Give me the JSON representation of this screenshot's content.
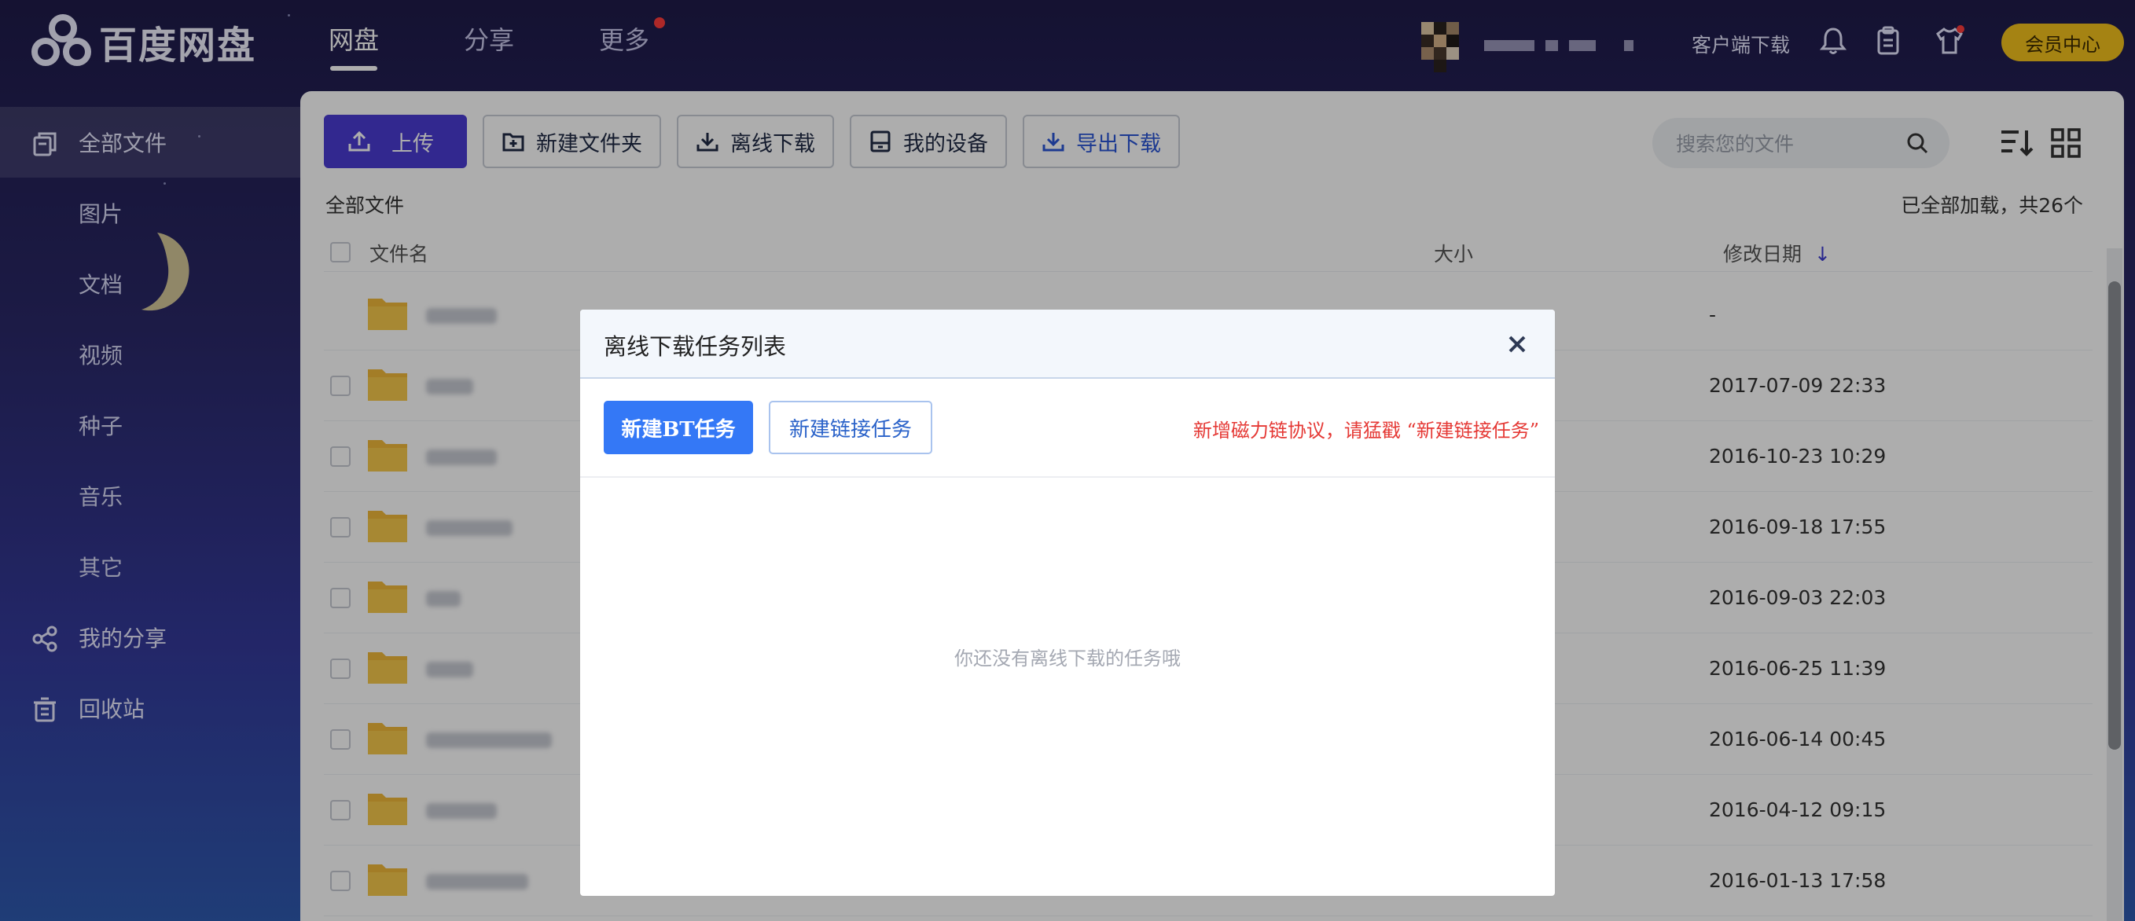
{
  "app": {
    "brand": "百度网盘"
  },
  "topnav": {
    "items": [
      {
        "label": "网盘",
        "active": true
      },
      {
        "label": "分享",
        "active": false
      },
      {
        "label": "更多",
        "active": false,
        "has_dot": true
      }
    ],
    "client_download": "客户端下载",
    "vip": "会员中心",
    "icons": [
      "bell-icon",
      "clipboard-icon",
      "tshirt-icon"
    ]
  },
  "sidebar": {
    "items": [
      {
        "label": "全部文件",
        "icon": "files-icon",
        "active": true
      },
      {
        "label": "图片"
      },
      {
        "label": "文档"
      },
      {
        "label": "视频"
      },
      {
        "label": "种子"
      },
      {
        "label": "音乐"
      },
      {
        "label": "其它"
      },
      {
        "label": "我的分享",
        "icon": "share-icon"
      },
      {
        "label": "回收站",
        "icon": "trash-icon"
      }
    ]
  },
  "toolbar": {
    "upload": "上传",
    "new_folder": "新建文件夹",
    "offline_download": "离线下载",
    "my_devices": "我的设备",
    "export_download": "导出下载"
  },
  "search": {
    "placeholder": "搜索您的文件"
  },
  "filelist": {
    "breadcrumb": "全部文件",
    "loaded_text": "已全部加载，共26个",
    "columns": {
      "name": "文件名",
      "size": "大小",
      "modified": "修改日期"
    },
    "rows": [
      {
        "date": "-"
      },
      {
        "date": "2017-07-09 22:33"
      },
      {
        "date": "2016-10-23 10:29"
      },
      {
        "date": "2016-09-18 17:55"
      },
      {
        "date": "2016-09-03 22:03"
      },
      {
        "date": "2016-06-25 11:39"
      },
      {
        "date": "2016-06-14 00:45"
      },
      {
        "date": "2016-04-12 09:15"
      },
      {
        "date": "2016-01-13 17:58"
      }
    ]
  },
  "modal": {
    "title": "离线下载任务列表",
    "new_bt": "新建BT任务",
    "new_link": "新建链接任务",
    "notice": "新增磁力链协议，请猛戳 “新建链接任务”",
    "empty": "你还没有离线下载的任务哦"
  },
  "colors": {
    "accent": "#4a3bd3",
    "primary_blue": "#3478f6",
    "notice_red": "#e53935",
    "vip_gold": "#f3c11d"
  }
}
